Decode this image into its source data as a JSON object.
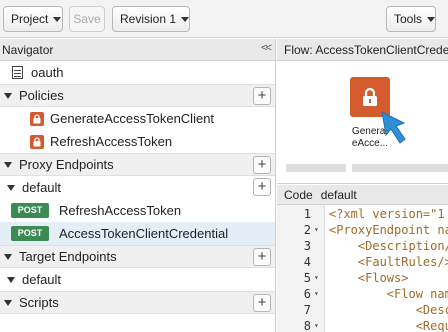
{
  "toolbar": {
    "project_label": "Project",
    "save_label": "Save",
    "revision_label": "Revision 1",
    "tools_label": "Tools"
  },
  "navigator": {
    "title": "Navigator",
    "collapse_label": "<<",
    "top_item": "oauth",
    "policies": {
      "label": "Policies",
      "items": [
        "GenerateAccessTokenClient",
        "RefreshAccessToken"
      ]
    },
    "proxy_endpoints": {
      "label": "Proxy Endpoints",
      "default_label": "default",
      "flows": [
        {
          "method": "POST",
          "name": "RefreshAccessToken"
        },
        {
          "method": "POST",
          "name": "AccessTokenClientCredential"
        }
      ]
    },
    "target_endpoints": {
      "label": "Target Endpoints",
      "default_label": "default"
    },
    "scripts": {
      "label": "Scripts"
    },
    "add_symbol": "+"
  },
  "flow": {
    "title": "Flow: AccessTokenClientCredential",
    "policy_label_line1": "Generat",
    "policy_label_line2": "eAcce..."
  },
  "code": {
    "tab_label": "Code",
    "file_label": "default",
    "lines": [
      {
        "num": "1",
        "fold": "",
        "indent": "",
        "text": "<?xml version=\"1"
      },
      {
        "num": "2",
        "fold": "▾",
        "indent": "",
        "text": "<ProxyEndpoint na"
      },
      {
        "num": "3",
        "fold": "",
        "indent": "    ",
        "text": "<Description/>"
      },
      {
        "num": "4",
        "fold": "",
        "indent": "    ",
        "text": "<FaultRules/>"
      },
      {
        "num": "5",
        "fold": "▾",
        "indent": "    ",
        "text": "<Flows>"
      },
      {
        "num": "6",
        "fold": "▾",
        "indent": "        ",
        "text": "<Flow nam"
      },
      {
        "num": "7",
        "fold": "",
        "indent": "            ",
        "text": "<Desc"
      },
      {
        "num": "8",
        "fold": "▾",
        "indent": "            ",
        "text": "<Requ"
      }
    ]
  },
  "colors": {
    "policy_accent": "#d35b2e",
    "post_badge": "#3d8b54",
    "selection": "#e3eef7",
    "pointer": "#2f8fd6"
  }
}
